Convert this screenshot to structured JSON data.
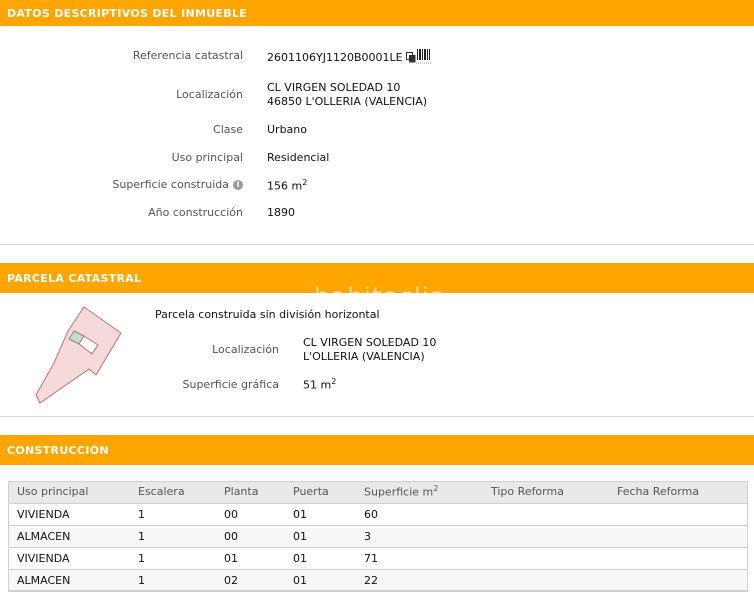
{
  "datos": {
    "header": "DATOS DESCRIPTIVOS DEL INMUEBLE",
    "referencia_label": "Referencia catastral",
    "referencia_value": "2601106YJ1120B0001LE",
    "localizacion_label": "Localización",
    "localizacion_line1": "CL VIRGEN SOLEDAD 10",
    "localizacion_line2": "46850 L'OLLERIA (VALENCIA)",
    "clase_label": "Clase",
    "clase_value": "Urbano",
    "uso_label": "Uso principal",
    "uso_value": "Residencial",
    "superficie_label": "Superficie construida",
    "superficie_value": "156 m",
    "superficie_sup": "2",
    "anio_label": "Año construcción",
    "anio_value": "1890"
  },
  "parcela": {
    "header": "PARCELA CATASTRAL",
    "descripcion": "Parcela construida sin división horizontal",
    "localizacion_label": "Localización",
    "localizacion_line1": "CL VIRGEN SOLEDAD 10",
    "localizacion_line2": "L'OLLERIA (VALENCIA)",
    "superficie_label": "Superficie gráfica",
    "superficie_value": "51 m",
    "superficie_sup": "2"
  },
  "watermark": "habitaclia",
  "construccion": {
    "header": "CONSTRUCCIÓN",
    "columns": [
      "Uso principal",
      "Escalera",
      "Planta",
      "Puerta",
      "Superficie m",
      "Tipo Reforma",
      "Fecha Reforma"
    ],
    "superficie_sup": "2",
    "rows": [
      [
        "VIVIENDA",
        "1",
        "00",
        "01",
        "60",
        "",
        ""
      ],
      [
        "ALMACEN",
        "1",
        "00",
        "01",
        "3",
        "",
        ""
      ],
      [
        "VIVIENDA",
        "1",
        "01",
        "01",
        "71",
        "",
        ""
      ],
      [
        "ALMACEN",
        "1",
        "02",
        "01",
        "22",
        "",
        ""
      ]
    ]
  },
  "icons": {
    "copy": "copy-icon",
    "barcode": "barcode-icon",
    "info": "info-icon"
  },
  "colors": {
    "header_bg": "#ffa500",
    "parcel_fill": "#f6dada",
    "parcel_stroke": "#c07070",
    "building_fill": "#b9e0cf"
  }
}
